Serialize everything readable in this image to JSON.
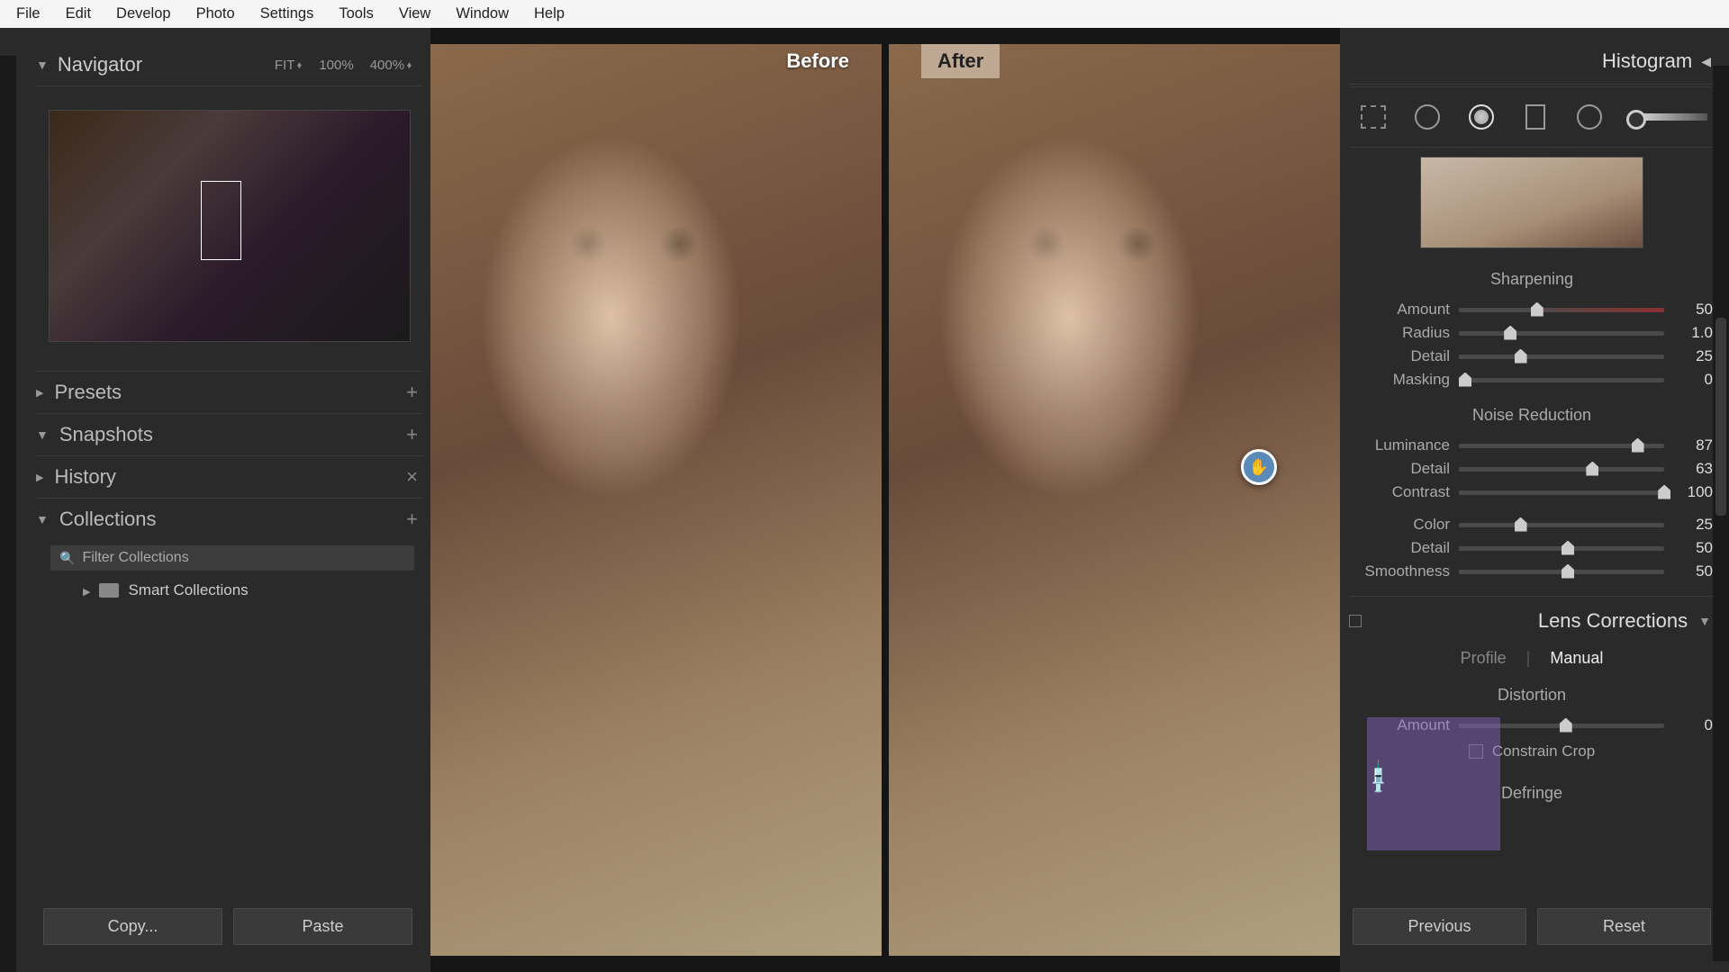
{
  "menu": {
    "items": [
      "File",
      "Edit",
      "Develop",
      "Photo",
      "Settings",
      "Tools",
      "View",
      "Window",
      "Help"
    ]
  },
  "left": {
    "navigator": {
      "title": "Navigator",
      "fit_label": "FIT",
      "zoom1": "100%",
      "zoom2": "400%"
    },
    "presets": {
      "title": "Presets"
    },
    "snapshots": {
      "title": "Snapshots"
    },
    "history": {
      "title": "History"
    },
    "collections": {
      "title": "Collections",
      "filter_placeholder": "Filter Collections",
      "smart": "Smart Collections"
    },
    "copy_btn": "Copy...",
    "paste_btn": "Paste"
  },
  "center": {
    "before_label": "Before",
    "after_label": "After"
  },
  "right": {
    "histogram": "Histogram",
    "sharpening": {
      "title": "Sharpening",
      "amount": {
        "label": "Amount",
        "value": "50",
        "pos": 35
      },
      "radius": {
        "label": "Radius",
        "value": "1.0",
        "pos": 22
      },
      "detail": {
        "label": "Detail",
        "value": "25",
        "pos": 27
      },
      "masking": {
        "label": "Masking",
        "value": "0",
        "pos": 0
      }
    },
    "noise": {
      "title": "Noise Reduction",
      "luminance": {
        "label": "Luminance",
        "value": "87",
        "pos": 84
      },
      "detail": {
        "label": "Detail",
        "value": "63",
        "pos": 62
      },
      "contrast": {
        "label": "Contrast",
        "value": "100",
        "pos": 97
      },
      "color": {
        "label": "Color",
        "value": "25",
        "pos": 27
      },
      "cdetail": {
        "label": "Detail",
        "value": "50",
        "pos": 50
      },
      "smoothness": {
        "label": "Smoothness",
        "value": "50",
        "pos": 50
      }
    },
    "lens": {
      "title": "Lens Corrections",
      "tab_profile": "Profile",
      "tab_manual": "Manual",
      "distortion_title": "Distortion",
      "dist_amount": {
        "label": "Amount",
        "value": "0",
        "pos": 49
      },
      "constrain": "Constrain Crop",
      "defringe": "Defringe"
    },
    "previous_btn": "Previous",
    "reset_btn": "Reset"
  }
}
